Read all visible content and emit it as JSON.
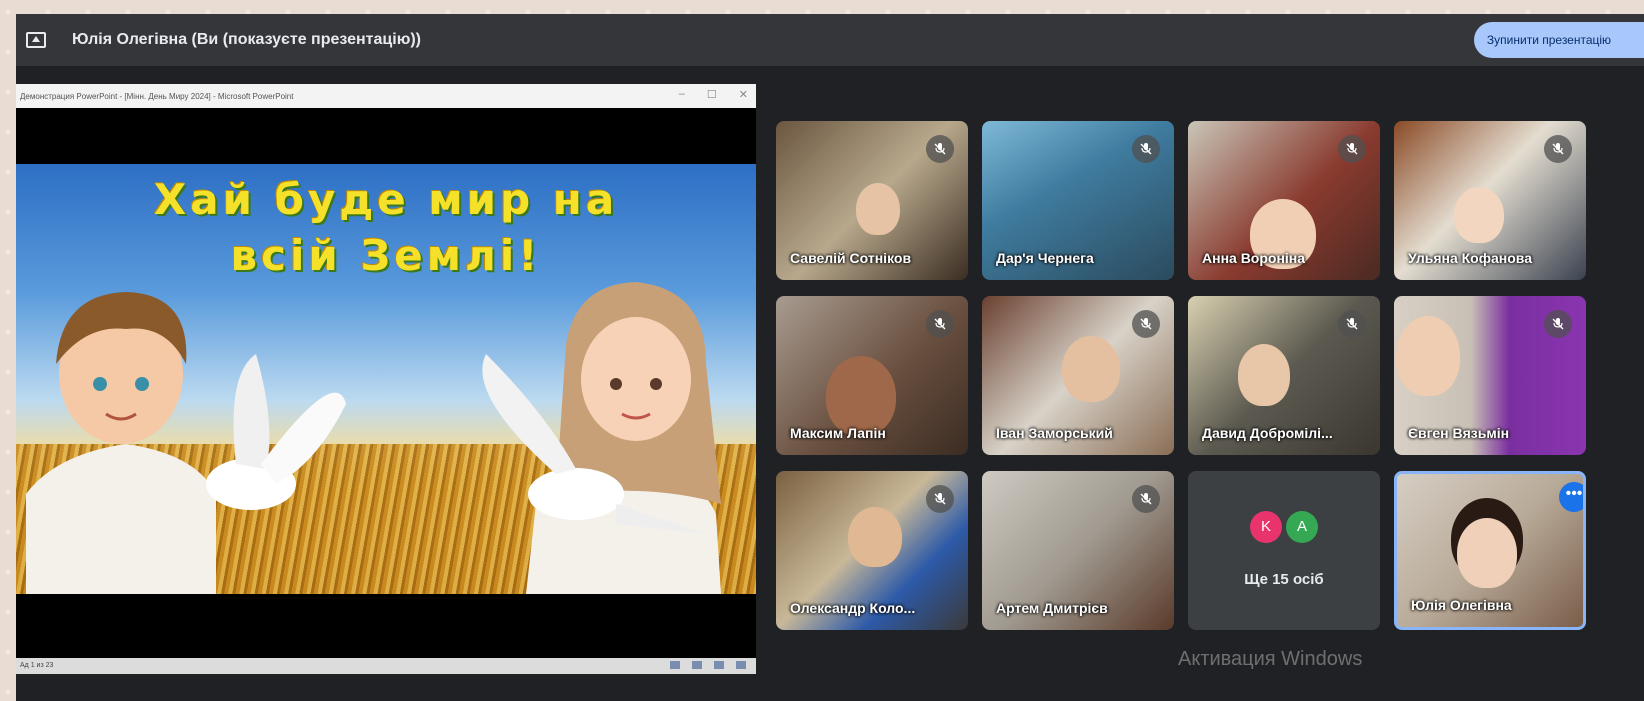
{
  "topbar": {
    "presenter_label": "Юлія Олегівна (Ви (показуєте презентацію))",
    "stop_button_label": "Зупинити презентацію"
  },
  "ppt": {
    "window_title": "Демонстрация PowerPoint - [Мінн. День Миру 2024] - Microsoft PowerPoint",
    "minimize": "–",
    "maximize": "☐",
    "close": "✕",
    "slide_title_line1": "Хай буде мир на",
    "slide_title_line2": "всій Землі!",
    "status_text": "Ад 1 из 23"
  },
  "participants": [
    {
      "name": "Савелій Сотніков",
      "muted": true
    },
    {
      "name": "Дар'я Чернега",
      "muted": true
    },
    {
      "name": "Анна Вороніна",
      "muted": true
    },
    {
      "name": "Ульяна Кофанова",
      "muted": true
    },
    {
      "name": "Максим Лапін",
      "muted": true
    },
    {
      "name": "Іван Заморський",
      "muted": true
    },
    {
      "name": "Давид Добромілі...",
      "muted": true
    },
    {
      "name": "Євген Вязьмін",
      "muted": true
    },
    {
      "name": "Олександр Коло...",
      "muted": true
    },
    {
      "name": "Артем Дмитрієв",
      "muted": true
    }
  ],
  "others_tile": {
    "avatars": [
      {
        "letter": "K",
        "color": "#e8336d"
      },
      {
        "letter": "A",
        "color": "#34a853"
      }
    ],
    "label": "Ще 15 осіб"
  },
  "self_tile": {
    "name": "Юлія Олегівна",
    "more_label": "•••"
  },
  "watermark": "Активация Windows",
  "colors": {
    "meet_bg": "#202124",
    "topbar_bg": "#35363a",
    "stop_button_bg": "#a8c7fa",
    "self_tile_border": "#8ab4f8"
  }
}
